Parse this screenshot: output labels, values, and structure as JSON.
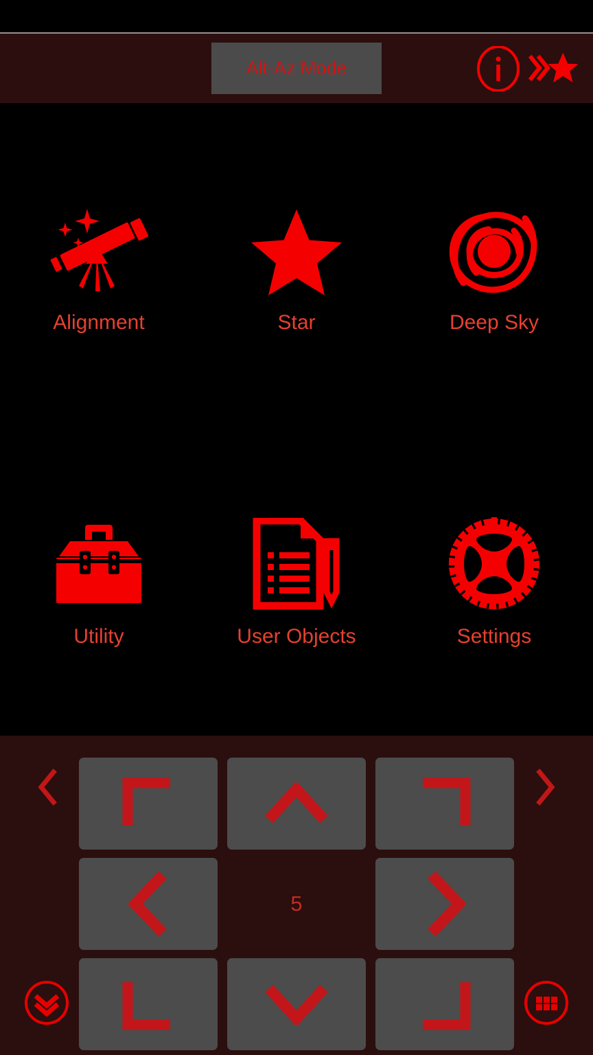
{
  "app": {
    "theme": {
      "background": "#000000",
      "panel_background": "#2b0e0e",
      "button_gray": "#4c4c4c",
      "accent_red": "#f50000",
      "label_red": "#e5412f",
      "dim_red": "#c22b22",
      "divider": "#9a8f8f"
    }
  },
  "status_bar": {
    "name": "status-bar"
  },
  "header": {
    "mode_button": {
      "label": "Alt-Az Mode",
      "icon": "none"
    },
    "info_button": {
      "icon": "info-circle-icon",
      "label": "i"
    },
    "goto_star_button": {
      "icon": "double-chevron-right-star-icon"
    }
  },
  "main": {
    "tiles": [
      {
        "label": "Alignment",
        "icon": "telescope-icon"
      },
      {
        "label": "Star",
        "icon": "star-icon"
      },
      {
        "label": "Deep Sky",
        "icon": "spiral-galaxy-icon"
      },
      {
        "label": "Utility",
        "icon": "toolbox-icon"
      },
      {
        "label": "User Objects",
        "icon": "document-pencil-icon"
      },
      {
        "label": "Settings",
        "icon": "gear-icon"
      }
    ]
  },
  "control_panel": {
    "nav_prev": {
      "icon": "chevron-left-icon"
    },
    "nav_next": {
      "icon": "chevron-right-icon"
    },
    "speed_value": "5",
    "dpad": [
      {
        "name": "dpad-up-left",
        "icon": "corner-top-left-icon"
      },
      {
        "name": "dpad-up",
        "icon": "chevron-up-icon"
      },
      {
        "name": "dpad-up-right",
        "icon": "corner-top-right-icon"
      },
      {
        "name": "dpad-left",
        "icon": "chevron-left-icon"
      },
      {
        "name": "dpad-center",
        "icon": "speed-value"
      },
      {
        "name": "dpad-right",
        "icon": "chevron-right-icon"
      },
      {
        "name": "dpad-down-left",
        "icon": "corner-bottom-left-icon"
      },
      {
        "name": "dpad-down",
        "icon": "chevron-down-icon"
      },
      {
        "name": "dpad-down-right",
        "icon": "corner-bottom-right-icon"
      }
    ],
    "collapse_button": {
      "icon": "double-chevron-down-circle-icon"
    },
    "grid_button": {
      "icon": "grid-dots-circle-icon"
    }
  }
}
